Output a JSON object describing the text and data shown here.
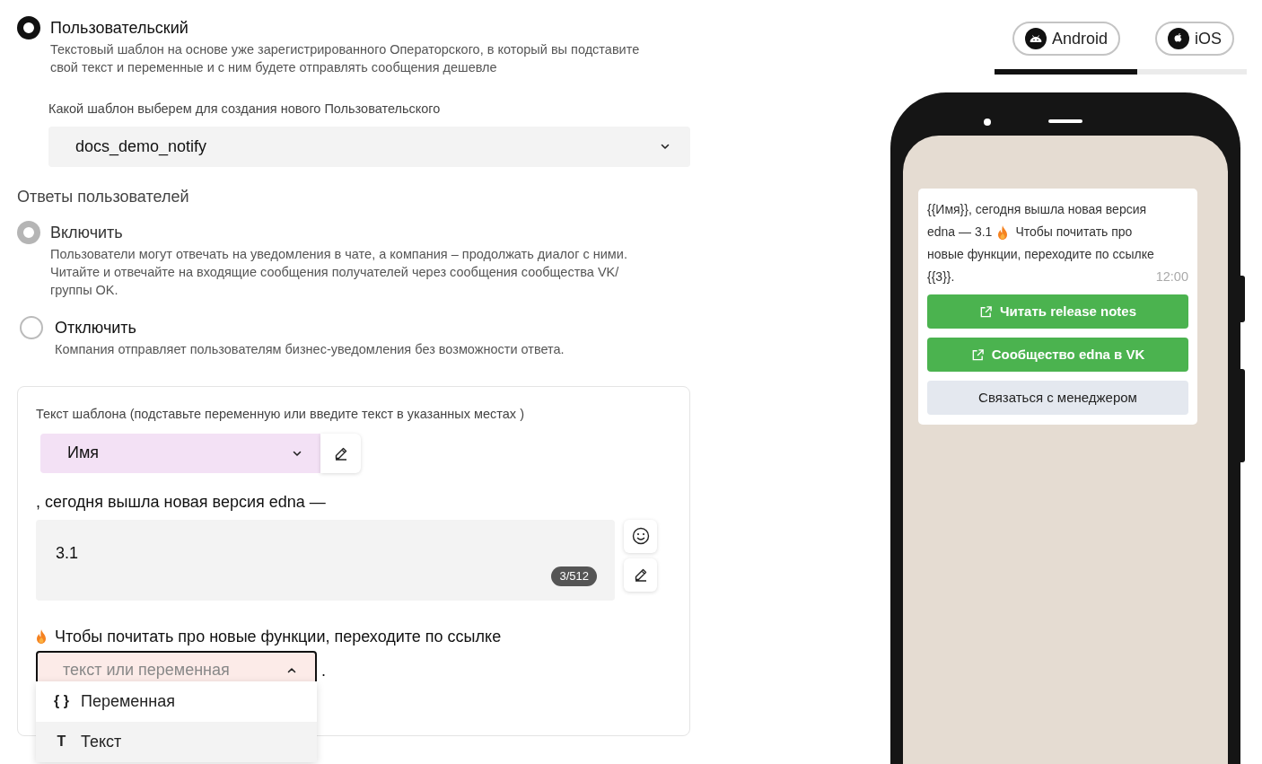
{
  "template_type": {
    "options": [
      {
        "label": "Пользовательский",
        "description": "Текстовый шаблон на основе уже зарегистрированного Операторского, в который вы подставите свой текст и переменные и с ним будете отправлять сообщения дешевле",
        "selected": true
      }
    ]
  },
  "base_template": {
    "label": "Какой шаблон выберем для создания нового Пользовательского",
    "value": "docs_demo_notify"
  },
  "replies": {
    "title": "Ответы пользователей",
    "options": [
      {
        "label": "Включить",
        "description": "Пользователи могут отвечать на уведомления в чате, а компания – продолжать диалог с ними. Читайте и отвечайте на входящие сообщения получателей через сообщения сообщества VK/ группы OK.",
        "selected": true,
        "disabled": true
      },
      {
        "label": "Отключить",
        "description": "Компания отправляет пользователям бизнес-уведомления без возможности ответа.",
        "selected": false,
        "disabled": false
      }
    ]
  },
  "template_text": {
    "label": "Текст шаблона (подставьте переменную или введите текст в указанных местах )",
    "variable": {
      "value": "Имя"
    },
    "segment_1": ", сегодня вышла новая версия edna —",
    "text_field": {
      "value": "3.1",
      "counter": "3/512"
    },
    "segment_2": "Чтобы почитать про новые функции, переходите по ссылке",
    "slot": {
      "placeholder": "текст или переменная",
      "expanded": true,
      "suffix": "."
    },
    "menu": [
      {
        "icon": "{ }",
        "label": "Переменная",
        "highlighted": false
      },
      {
        "icon": "T",
        "label": "Текст",
        "highlighted": true
      }
    ]
  },
  "preview": {
    "tabs": [
      {
        "label": "Android",
        "selected": true
      },
      {
        "label": "iOS",
        "selected": false
      }
    ],
    "message": {
      "lines": [
        {
          "segments": [
            "{{Имя}}, сегодня вышла новая версия"
          ]
        },
        {
          "segments": [
            "edna — 3.1",
            "Чтобы почитать про"
          ]
        },
        {
          "segments": [
            "новые функции, переходите по ссылке"
          ]
        },
        {
          "segments": [
            "{{3}}."
          ]
        }
      ],
      "time": "12:00"
    },
    "buttons": [
      {
        "kind": "link",
        "label": "Читать release notes"
      },
      {
        "kind": "link",
        "label": "Сообщество edna в VK"
      },
      {
        "kind": "reply",
        "label": "Связаться с менеджером"
      }
    ]
  }
}
